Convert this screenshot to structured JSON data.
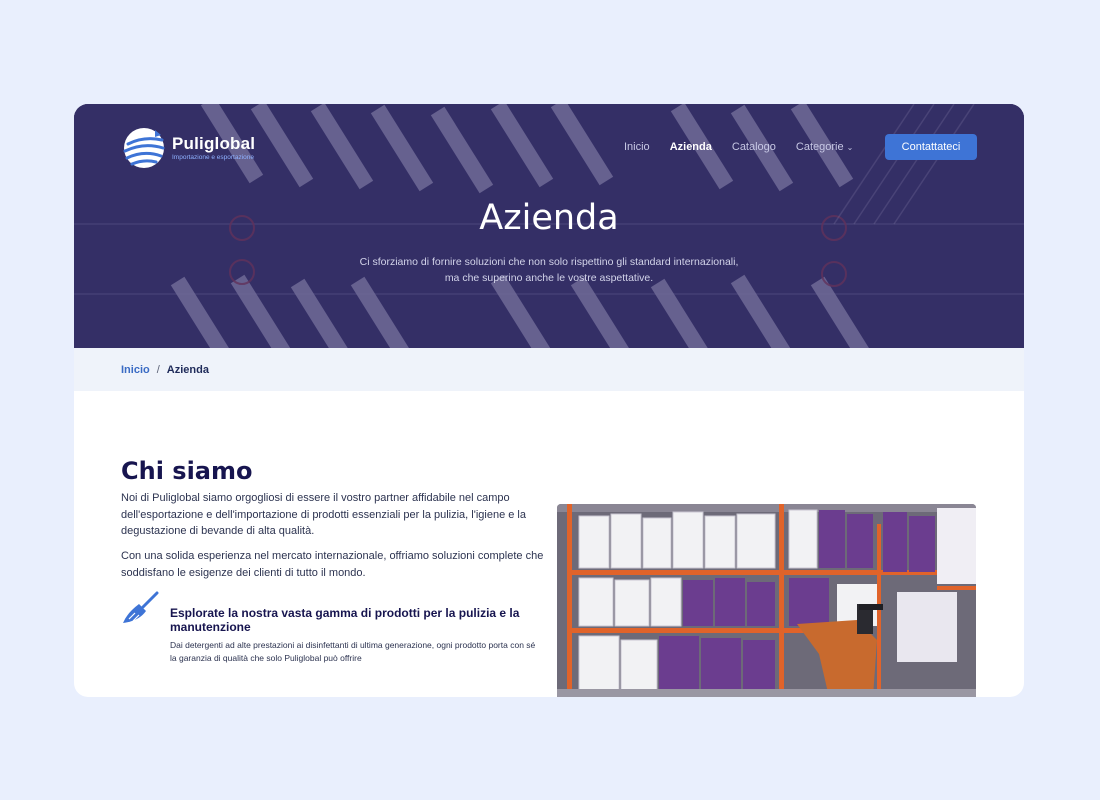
{
  "brand": {
    "name": "Puliglobal",
    "tagline": "Importazione e esportazione"
  },
  "nav": {
    "items": [
      {
        "label": "Inicio"
      },
      {
        "label": "Azienda"
      },
      {
        "label": "Catalogo"
      },
      {
        "label": "Categorie"
      }
    ],
    "active": "Azienda",
    "cta_label": "Contattateci"
  },
  "hero": {
    "title": "Azienda",
    "subtitle": "Ci sforziamo di fornire soluzioni che non solo rispettino gli standard internazionali, ma che superino anche le vostre aspettative."
  },
  "breadcrumb": {
    "home": "Inicio",
    "separator": "/",
    "current": "Azienda"
  },
  "about": {
    "title": "Chi siamo",
    "paragraphs": [
      "Noi di Puliglobal siamo orgogliosi di essere il vostro partner affidabile nel campo dell'esportazione e dell'importazione di prodotti essenziali per la pulizia, l'igiene e la degustazione di bevande di alta qualità.",
      "Con una solida esperienza nel mercato internazionale, offriamo soluzioni complete che soddisfano le esigenze dei clienti di tutto il mondo."
    ],
    "feature": {
      "icon": "broom-icon",
      "title": "Esplorate la nostra vasta gamma di prodotti per la pulizia e la manutenzione",
      "text": "Dai detergenti ad alte prestazioni ai disinfettanti di ultima generazione, ogni prodotto porta con sé la garanzia di qualità che solo Puliglobal può offrire"
    }
  },
  "colors": {
    "page_bg": "#e9effd",
    "hero_bg": "#2b2564",
    "accent": "#3e74d6",
    "heading": "#17154f",
    "breadcrumb_bg": "#eff3fa"
  }
}
